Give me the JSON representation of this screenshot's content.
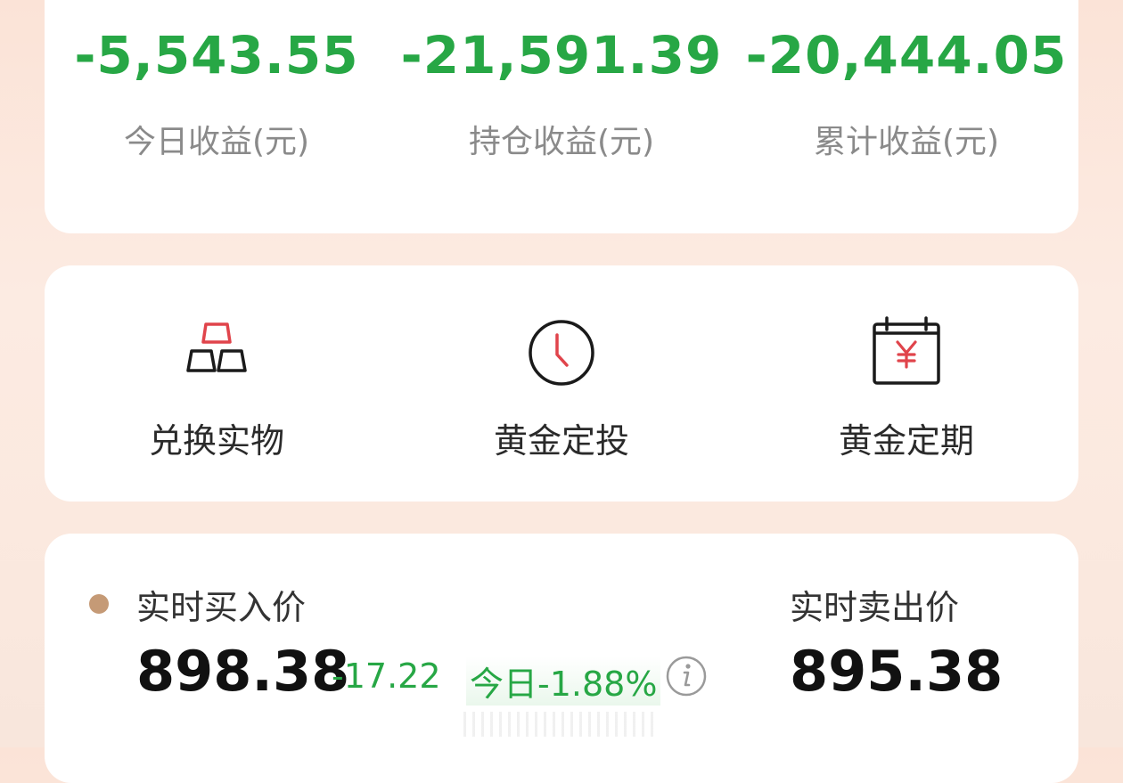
{
  "earnings": [
    {
      "value": "-5,543.55",
      "label": "今日收益(元)"
    },
    {
      "value": "-21,591.39",
      "label": "持仓收益(元)"
    },
    {
      "value": "-20,444.05",
      "label": "累计收益(元)"
    }
  ],
  "actions": [
    {
      "label": "兑换实物",
      "icon": "gold-bars-icon"
    },
    {
      "label": "黄金定投",
      "icon": "clock-icon"
    },
    {
      "label": "黄金定期",
      "icon": "calendar-yen-icon"
    }
  ],
  "price": {
    "buy_label": "实时买入价",
    "buy_value": "898.38",
    "buy_change": "-17.22",
    "today_pct": "今日-1.88%",
    "sell_label": "实时卖出价",
    "sell_value": "895.38"
  },
  "colors": {
    "negative": "#27a745",
    "accent_red": "#e0444b",
    "dot": "#c59a76"
  }
}
